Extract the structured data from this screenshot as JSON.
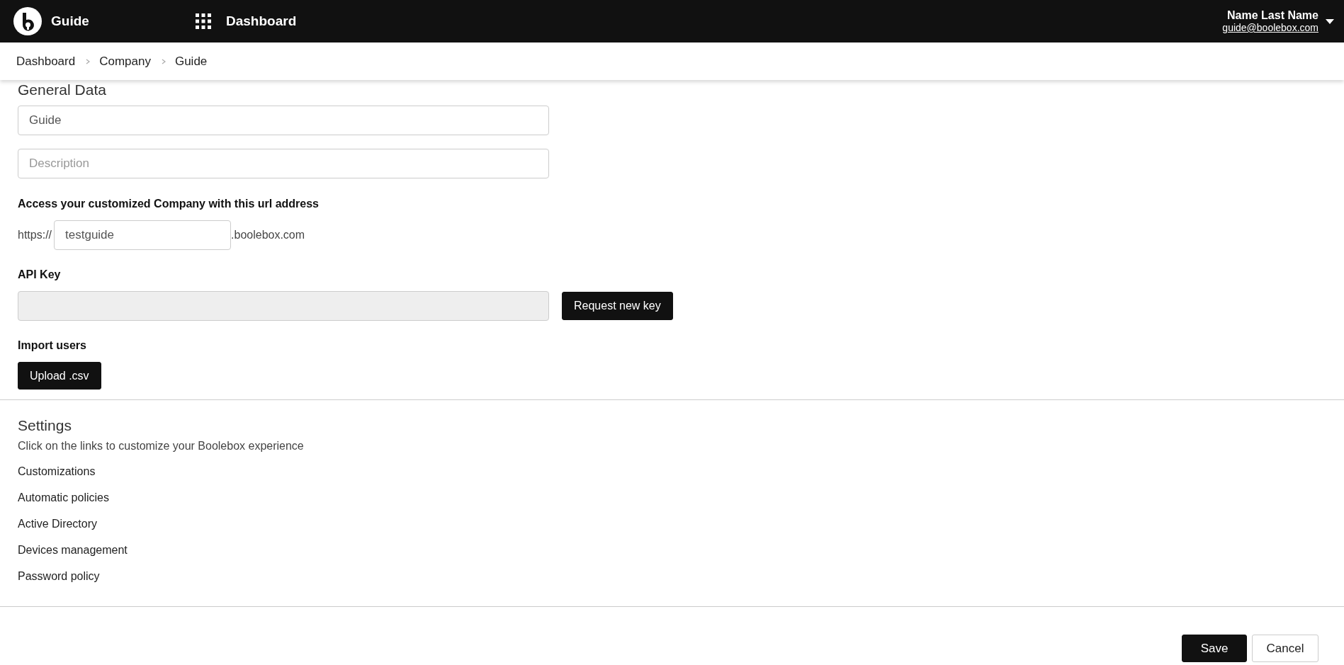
{
  "header": {
    "app_name": "Guide",
    "nav_label": "Dashboard",
    "user_name": "Name Last Name",
    "user_email": "guide@boolebox.com"
  },
  "breadcrumb": [
    {
      "label": "Dashboard"
    },
    {
      "label": "Company"
    },
    {
      "label": "Guide"
    }
  ],
  "general_data": {
    "title": "General Data",
    "name_field": {
      "value": "Guide"
    },
    "description_field": {
      "placeholder": "Description"
    },
    "url_label": "Access your customized Company with this url address",
    "url_prefix": "https://",
    "url_field": {
      "value": "testguide"
    },
    "url_suffix": ".boolebox.com",
    "api_key_label": "API Key",
    "api_key_field": {
      "disabled": true
    },
    "request_key_button": "Request new key",
    "import_label": "Import users",
    "upload_button": "Upload .csv"
  },
  "settings": {
    "title": "Settings",
    "description": "Click on the links to customize your Boolebox experience",
    "links": [
      "Customizations",
      "Automatic policies",
      "Active Directory",
      "Devices management",
      "Password policy"
    ]
  },
  "buttons": {
    "save": "Save",
    "cancel": "Cancel"
  }
}
